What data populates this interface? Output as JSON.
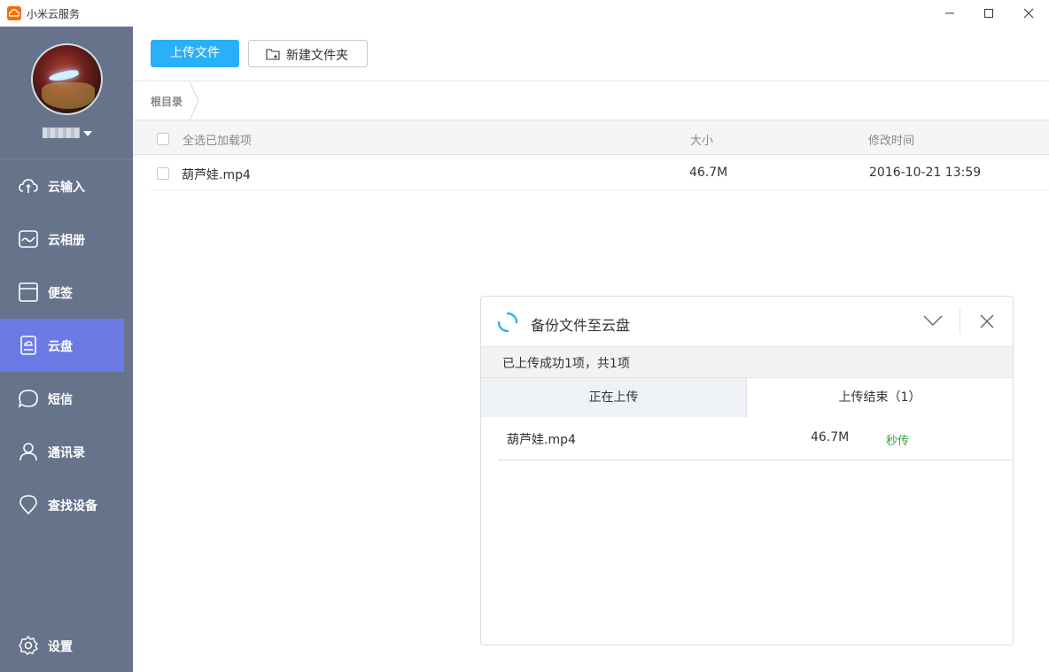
{
  "window": {
    "title": "小米云服务",
    "minimize_icon": "minimize-icon",
    "maximize_icon": "maximize-icon",
    "close_icon": "close-icon"
  },
  "sidebar": {
    "background": "#66738a",
    "active_color": "#6c7ae6",
    "items": [
      {
        "label": "云输入",
        "icon": "cloud-sync-icon"
      },
      {
        "label": "云相册",
        "icon": "gallery-icon"
      },
      {
        "label": "便签",
        "icon": "notes-icon"
      },
      {
        "label": "云盘",
        "icon": "cloud-drive-icon",
        "active": true
      },
      {
        "label": "短信",
        "icon": "message-icon"
      },
      {
        "label": "通讯录",
        "icon": "contacts-icon"
      },
      {
        "label": "查找设备",
        "icon": "location-pin-icon"
      }
    ],
    "settings": {
      "label": "设置",
      "icon": "gear-icon"
    }
  },
  "toolbar": {
    "upload_label": "上传文件",
    "newfolder_label": "新建文件夹",
    "upload_color": "#2ab0f8"
  },
  "breadcrumb": {
    "items": [
      "根目录"
    ]
  },
  "file_list": {
    "headers": {
      "select_all": "全选已加载项",
      "size": "大小",
      "mtime": "修改时间"
    },
    "rows": [
      {
        "name": "葫芦娃.mp4",
        "size": "46.7M",
        "mtime": "2016-10-21 13:59"
      }
    ]
  },
  "upload_panel": {
    "title": "备份文件至云盘",
    "status": "已上传成功1项，共1项",
    "tabs": {
      "uploading": "正在上传",
      "done": "上传结束（1）"
    },
    "rows": [
      {
        "name": "葫芦娃.mp4",
        "size": "46.7M",
        "status": "秒传"
      }
    ],
    "status_color": "#2aa640"
  }
}
